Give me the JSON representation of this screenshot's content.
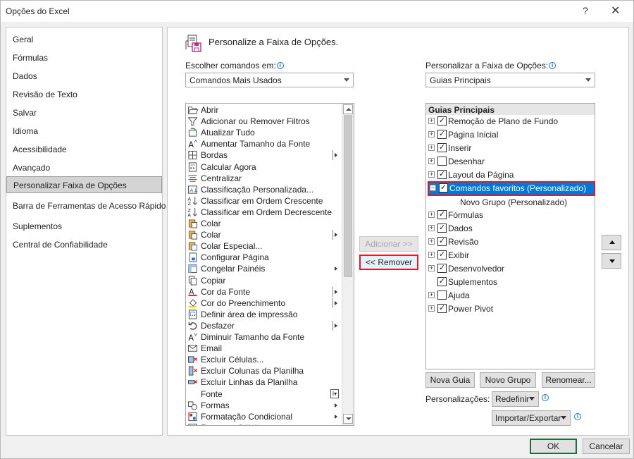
{
  "window": {
    "title": "Opções do Excel",
    "help": "?",
    "close": "✕"
  },
  "nav": {
    "items": [
      {
        "label": "Geral"
      },
      {
        "label": "Fórmulas"
      },
      {
        "label": "Dados"
      },
      {
        "label": "Revisão de Texto"
      },
      {
        "label": "Salvar"
      },
      {
        "label": "Idioma"
      },
      {
        "label": "Acessibilidade"
      },
      {
        "label": "Avançado"
      },
      {
        "label": "Personalizar Faixa de Opções",
        "active": true
      },
      {
        "label": "Barra de Ferramentas de Acesso Rápido"
      },
      {
        "label": "Suplementos"
      },
      {
        "label": "Central de Confiabilidade"
      }
    ]
  },
  "header": {
    "title": "Personalize a Faixa de Opções."
  },
  "left": {
    "label": "Escolher comandos em:",
    "combo_value": "Comandos Mais Usados",
    "commands": [
      {
        "label": "Abrir",
        "icon": "folder-open-icon"
      },
      {
        "label": "Adicionar ou Remover Filtros",
        "icon": "filter-icon"
      },
      {
        "label": "Atualizar Tudo",
        "icon": "refresh-all-icon"
      },
      {
        "label": "Aumentar Tamanho da Fonte",
        "icon": "font-grow-icon"
      },
      {
        "label": "Bordas",
        "icon": "borders-icon",
        "submenu": "split"
      },
      {
        "label": "Calcular Agora",
        "icon": "calculator-icon"
      },
      {
        "label": "Centralizar",
        "icon": "align-center-icon"
      },
      {
        "label": "Classificação Personalizada...",
        "icon": "custom-sort-icon"
      },
      {
        "label": "Classificar em Ordem Crescente",
        "icon": "sort-ascending-icon"
      },
      {
        "label": "Classificar em Ordem Decrescente",
        "icon": "sort-descending-icon"
      },
      {
        "label": "Colar",
        "icon": "paste-icon"
      },
      {
        "label": "Colar",
        "icon": "paste-icon",
        "submenu": "split"
      },
      {
        "label": "Colar Especial...",
        "icon": "paste-special-icon"
      },
      {
        "label": "Configurar Página",
        "icon": "page-setup-icon"
      },
      {
        "label": "Congelar Painéis",
        "icon": "freeze-panes-icon",
        "submenu": "arrow"
      },
      {
        "label": "Copiar",
        "icon": "copy-icon"
      },
      {
        "label": "Cor da Fonte",
        "icon": "font-color-icon",
        "submenu": "split"
      },
      {
        "label": "Cor do Preenchimento",
        "icon": "fill-color-icon",
        "submenu": "split"
      },
      {
        "label": "Definir área de impressão",
        "icon": "print-area-icon"
      },
      {
        "label": "Desfazer",
        "icon": "undo-icon",
        "submenu": "split"
      },
      {
        "label": "Diminuir Tamanho da Fonte",
        "icon": "font-shrink-icon"
      },
      {
        "label": "Email",
        "icon": "email-icon"
      },
      {
        "label": "Excluir Células...",
        "icon": "delete-cells-icon"
      },
      {
        "label": "Excluir Colunas da Planilha",
        "icon": "delete-columns-icon"
      },
      {
        "label": "Excluir Linhas da Planilha",
        "icon": "delete-rows-icon"
      },
      {
        "label": "Fonte",
        "icon": "font-icon",
        "submenu": "box"
      },
      {
        "label": "Formas",
        "icon": "shapes-icon",
        "submenu": "arrow"
      },
      {
        "label": "Formatação Condicional",
        "icon": "conditional-format-icon",
        "submenu": "arrow"
      },
      {
        "label": "Formatar Células",
        "icon": "format-cells-icon"
      }
    ]
  },
  "middle": {
    "add_label": "Adicionar >>",
    "remove_label": "<< Remover"
  },
  "right": {
    "label": "Personalizar a Faixa de Opções:",
    "combo_value": "Guias Principais",
    "tree_header": "Guias Principais",
    "tree": [
      {
        "label": "Remoção de Plano de Fundo",
        "checked": true,
        "expander": "+",
        "level": 0
      },
      {
        "label": "Página Inicial",
        "checked": true,
        "expander": "+",
        "level": 0
      },
      {
        "label": "Inserir",
        "checked": true,
        "expander": "+",
        "level": 0
      },
      {
        "label": "Desenhar",
        "checked": false,
        "expander": "+",
        "level": 0
      },
      {
        "label": "Layout da Página",
        "checked": true,
        "expander": "+",
        "level": 0
      },
      {
        "label": "Comandos favoritos (Personalizado)",
        "checked": true,
        "expander": "−",
        "level": 0,
        "selected": true
      },
      {
        "label": "Novo Grupo (Personalizado)",
        "level": 1
      },
      {
        "label": "Fórmulas",
        "checked": true,
        "expander": "+",
        "level": 0
      },
      {
        "label": "Dados",
        "checked": true,
        "expander": "+",
        "level": 0
      },
      {
        "label": "Revisão",
        "checked": true,
        "expander": "+",
        "level": 0
      },
      {
        "label": "Exibir",
        "checked": true,
        "expander": "+",
        "level": 0
      },
      {
        "label": "Desenvolvedor",
        "checked": true,
        "expander": "+",
        "level": 0
      },
      {
        "label": "Suplementos",
        "checked": true,
        "level": 0
      },
      {
        "label": "Ajuda",
        "checked": false,
        "expander": "+",
        "level": 0
      },
      {
        "label": "Power Pivot",
        "checked": true,
        "expander": "+",
        "level": 0
      }
    ],
    "new_tab": "Nova Guia",
    "new_group": "Novo Grupo",
    "rename": "Renomear...",
    "customizations_label": "Personalizações:",
    "reset": "Redefinir",
    "import_export": "Importar/Exportar"
  },
  "footer": {
    "ok": "OK",
    "cancel": "Cancelar"
  },
  "colors": {
    "selection": "#0078d7",
    "highlight": "#e01b24",
    "ok_border": "#1c6d3a"
  }
}
